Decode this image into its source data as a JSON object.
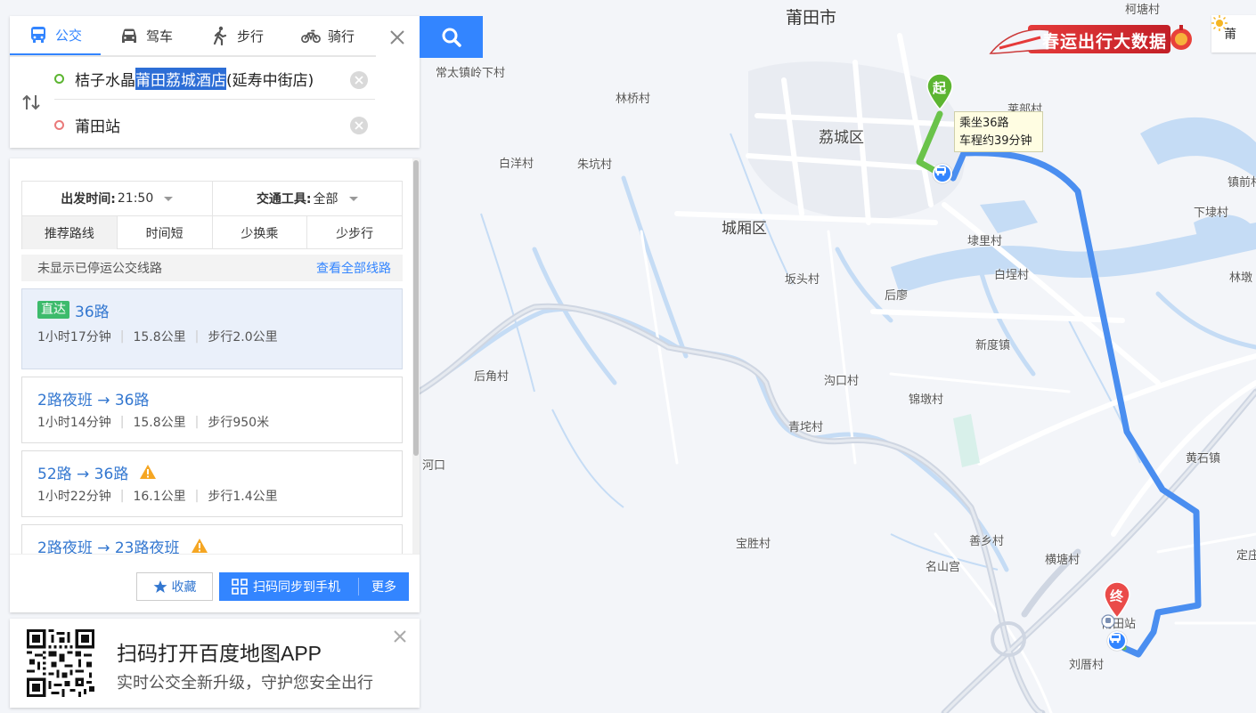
{
  "mode_tabs": [
    {
      "label": "公交",
      "icon": "bus-icon",
      "active": true
    },
    {
      "label": "驾车",
      "icon": "car-icon",
      "active": false
    },
    {
      "label": "步行",
      "icon": "walk-icon",
      "active": false
    },
    {
      "label": "骑行",
      "icon": "bike-icon",
      "active": false
    }
  ],
  "route": {
    "start_prefix": "桔子水晶",
    "start_selected": "莆田荔城酒店",
    "start_suffix": "(延寿中街店)",
    "end": "莆田站"
  },
  "filters": {
    "depart_label": "出发时间:",
    "depart_value": "21:50",
    "transport_label": "交通工具:",
    "transport_value": "全部"
  },
  "sort_tabs": [
    "推荐路线",
    "时间短",
    "少换乘",
    "少步行"
  ],
  "notice": {
    "text": "未显示已停运公交线路",
    "link": "查看全部线路"
  },
  "routes": [
    {
      "tag": "直达",
      "title": "36路",
      "duration": "1小时17分钟",
      "distance": "15.8公里",
      "walk": "步行2.0公里",
      "warning": false
    },
    {
      "tag": "",
      "title": "2路夜班 → 36路",
      "duration": "1小时14分钟",
      "distance": "15.8公里",
      "walk": "步行950米",
      "warning": false
    },
    {
      "tag": "",
      "title": "52路 → 36路",
      "duration": "1小时22分钟",
      "distance": "16.1公里",
      "walk": "步行1.4公里",
      "warning": true
    },
    {
      "tag": "",
      "title": "2路夜班 → 23路夜班",
      "duration": "",
      "distance": "",
      "walk": "",
      "warning": true
    }
  ],
  "actions": {
    "favorite": "收藏",
    "sync": "扫码同步到手机",
    "more": "更多"
  },
  "promo": {
    "title": "扫码打开百度地图APP",
    "subtitle": "实时公交全新升级，守护您安全出行"
  },
  "map": {
    "banner_text": "春运出行大数据",
    "weather_text": "莆",
    "tooltip_line1": "乘坐36路",
    "tooltip_line2": "车程约39分钟",
    "start_marker": "起",
    "end_marker": "终",
    "station_label": "莆田站",
    "labels": {
      "putian_city": "莆田市",
      "ketang": "柯塘村",
      "changtai": "常太镇岭下村",
      "linqiao": "林桥村",
      "baiyang": "白洋村",
      "zhukeng": "朱坑村",
      "licheng": "荔城区",
      "chengxiang": "城厢区",
      "liling": "莱部村",
      "zhenqian": "镇前村",
      "xiadai": "下埭村",
      "lidou": "埭里村",
      "baicheng": "白埕村",
      "linhan": "林墩",
      "bantou": "坂头村",
      "houlian": "后廖",
      "xindu": "新度镇",
      "houjiao": "后角村",
      "goukou": "沟口村",
      "jindun": "锦墩村",
      "qingdu": "青垞村",
      "huangshi": "黄石镇",
      "baosheng": "宝胜村",
      "shanxiang": "善乡村",
      "mingshan": "名山宫",
      "hengtang": "横塘村",
      "dingzhuang": "定庄",
      "liucuo": "刘厝村",
      "hekou": "河口"
    }
  },
  "colors": {
    "accent": "#3385ff",
    "route_blue": "#4a8ef0",
    "walk_green": "#6ac34a",
    "start_green": "#5cb531",
    "end_red": "#ea4b49",
    "direct_tag": "#3dbb6c",
    "warning": "#f5a623"
  }
}
